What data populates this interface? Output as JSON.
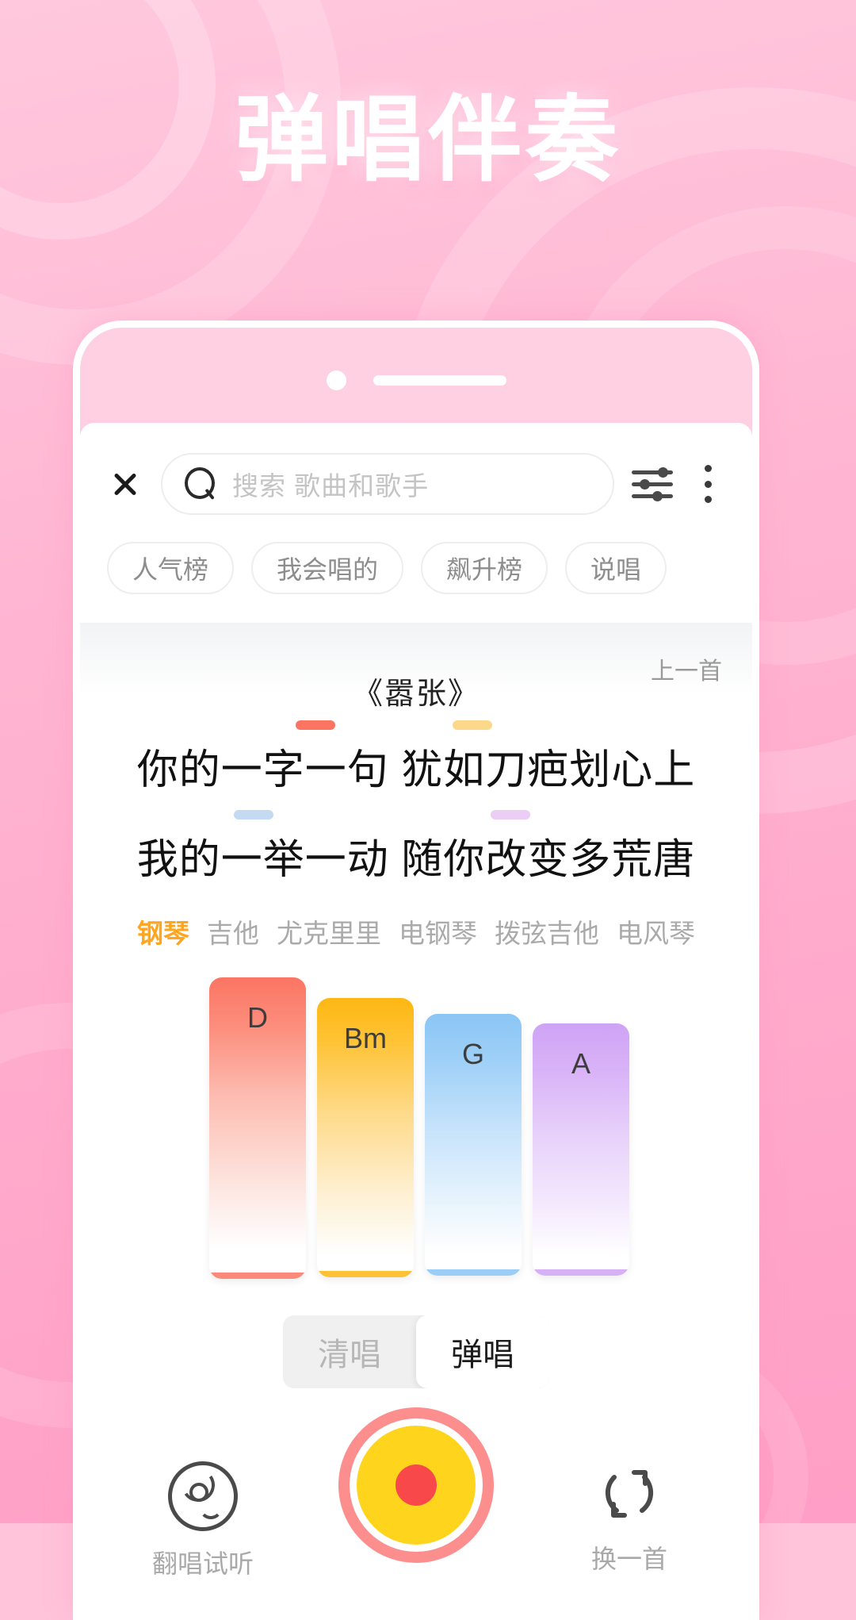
{
  "headline": "弹唱伴奏",
  "topbar": {
    "close_icon": "close-icon",
    "search_placeholder": "搜索 歌曲和歌手",
    "search_value": "",
    "search_icon": "search-icon",
    "equalizer_icon": "equalizer-icon",
    "more_icon": "more-vertical-icon"
  },
  "chips": [
    {
      "label": "人气榜"
    },
    {
      "label": "我会唱的"
    },
    {
      "label": "飙升榜"
    },
    {
      "label": "说唱"
    }
  ],
  "player": {
    "prev_song_label": "上一首",
    "song_title": "《嚣张》",
    "lyrics": [
      {
        "text": "你的一字一句 犹如刀疤划心上"
      },
      {
        "text": "我的一举一动 随你改变多荒唐"
      }
    ],
    "chord_marks": [
      {
        "color": "#fc7563",
        "line": 1
      },
      {
        "color": "#fcd98a",
        "line": 1
      },
      {
        "color": "#c3daf2",
        "line": 2
      },
      {
        "color": "#eccdf5",
        "line": 2
      }
    ],
    "instruments": [
      {
        "label": "钢琴",
        "active": true
      },
      {
        "label": "吉他",
        "active": false
      },
      {
        "label": "尤克里里",
        "active": false
      },
      {
        "label": "电钢琴",
        "active": false
      },
      {
        "label": "拨弦吉他",
        "active": false
      },
      {
        "label": "电风琴",
        "active": false
      }
    ],
    "active_instrument_color": "#ffa51e",
    "chord_keys": [
      {
        "label": "D",
        "color": "#fc7563"
      },
      {
        "label": "Bm",
        "color": "#fdb713"
      },
      {
        "label": "G",
        "color": "#8ac6f5"
      },
      {
        "label": "A",
        "color": "#cfa3f5"
      }
    ],
    "mode_toggle": [
      {
        "label": "清唱",
        "selected": false
      },
      {
        "label": "弹唱",
        "selected": true
      }
    ],
    "left_action": {
      "label": "翻唱试听",
      "icon": "disc-icon"
    },
    "right_action": {
      "label": "换一首",
      "icon": "refresh-icon"
    },
    "record_button": {
      "icon": "record-icon",
      "ring_color": "#fc8e8e",
      "body_color": "#ffd41d",
      "dot_color": "#f9484a"
    }
  }
}
